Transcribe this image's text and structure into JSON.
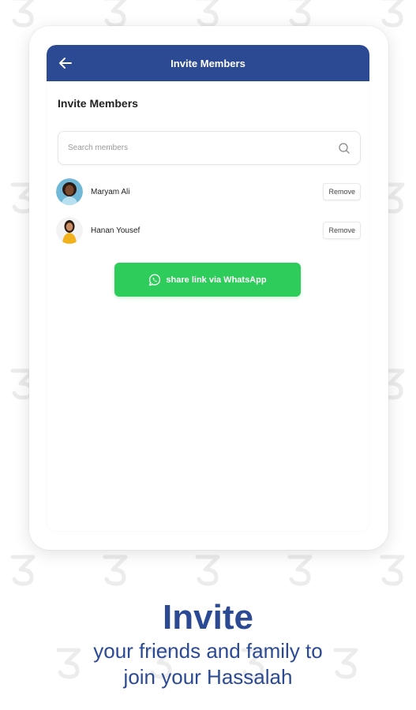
{
  "appbar": {
    "title": "Invite Members"
  },
  "section_title": "Invite Members",
  "search": {
    "placeholder": "Search members",
    "value": ""
  },
  "members": [
    {
      "name": "Maryam Ali",
      "remove_label": "Remove"
    },
    {
      "name": "Hanan Yousef",
      "remove_label": "Remove"
    }
  ],
  "share_button": {
    "label": "share link via WhatsApp",
    "icon": "whatsapp-icon"
  },
  "caption": {
    "title": "Invite",
    "line1": "your friends and family to",
    "line2": "join your Hassalah"
  },
  "colors": {
    "brand": "#2c4a94",
    "whatsapp_green": "#2ecc5a",
    "pattern": "#ececec"
  }
}
